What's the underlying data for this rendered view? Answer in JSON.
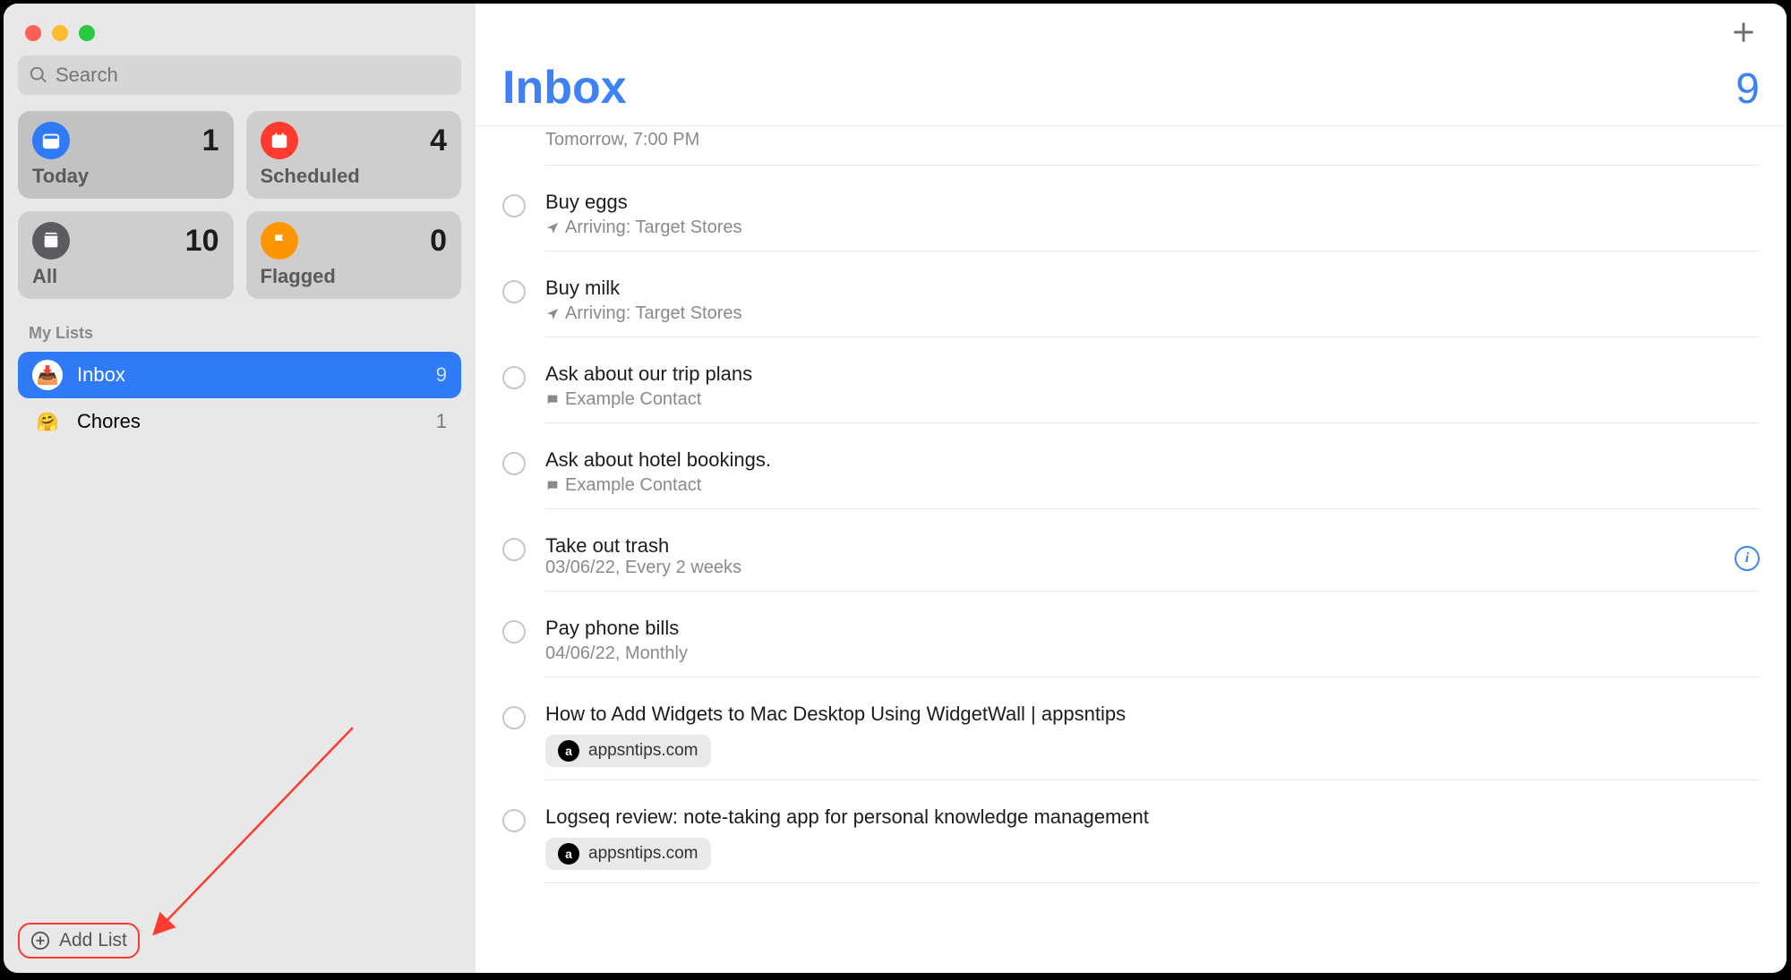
{
  "search": {
    "placeholder": "Search"
  },
  "smart_lists": [
    {
      "id": "today",
      "label": "Today",
      "count": "1",
      "icon_color": "#2f7af6"
    },
    {
      "id": "scheduled",
      "label": "Scheduled",
      "count": "4",
      "icon_color": "#ff3b30"
    },
    {
      "id": "all",
      "label": "All",
      "count": "10",
      "icon_color": "#5b5b60"
    },
    {
      "id": "flagged",
      "label": "Flagged",
      "count": "0",
      "icon_color": "#ff9500"
    }
  ],
  "my_lists_title": "My Lists",
  "lists": [
    {
      "id": "inbox",
      "label": "Inbox",
      "count": "9",
      "emoji": "📥",
      "icon_bg": "#2f7af6",
      "selected": true
    },
    {
      "id": "chores",
      "label": "Chores",
      "count": "1",
      "emoji": "🤗",
      "icon_bg": "transparent",
      "selected": false
    }
  ],
  "add_list_label": "Add List",
  "header": {
    "title": "Inbox",
    "count": "9"
  },
  "tasks": [
    {
      "partial": true,
      "title": "",
      "subtitle": "Tomorrow, 7:00 PM",
      "sub_icon": ""
    },
    {
      "title": "Buy eggs",
      "subtitle": "Arriving: Target Stores",
      "sub_icon": "location"
    },
    {
      "title": "Buy milk",
      "subtitle": "Arriving: Target Stores",
      "sub_icon": "location"
    },
    {
      "title": "Ask about our trip plans",
      "subtitle": "Example Contact",
      "sub_icon": "chat"
    },
    {
      "title": "Ask about hotel bookings.",
      "subtitle": "Example Contact",
      "sub_icon": "chat"
    },
    {
      "title": "Take out trash",
      "subtitle": "03/06/22, Every 2 weeks",
      "sub_icon": "",
      "info": true
    },
    {
      "title": "Pay phone bills",
      "subtitle": "04/06/22, Monthly",
      "sub_icon": ""
    },
    {
      "title": "How to Add Widgets to Mac Desktop Using WidgetWall | appsntips",
      "link": "appsntips.com"
    },
    {
      "title": "Logseq review: note-taking app for personal knowledge management",
      "link": "appsntips.com"
    }
  ]
}
